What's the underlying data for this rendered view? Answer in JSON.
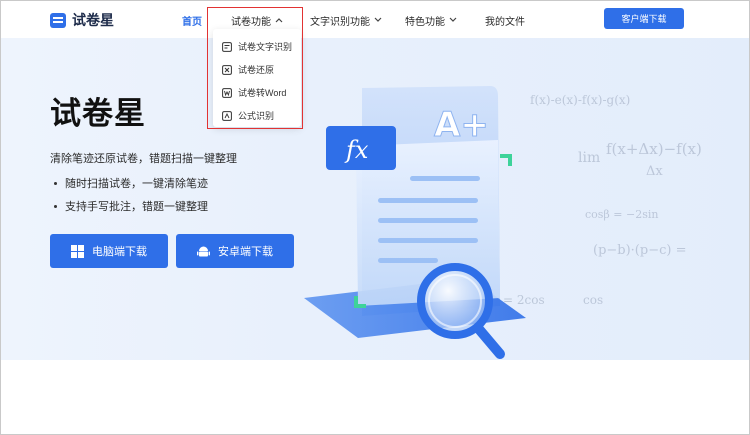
{
  "brand": {
    "name": "试卷星"
  },
  "nav": {
    "items": [
      {
        "label": "首页"
      },
      {
        "label": "试卷功能"
      },
      {
        "label": "文字识别功能"
      },
      {
        "label": "特色功能"
      },
      {
        "label": "我的文件"
      }
    ],
    "client_download": "客户端下载"
  },
  "dropdown": {
    "items": [
      {
        "label": "试卷文字识别",
        "icon": "doc-text-icon"
      },
      {
        "label": "试卷还原",
        "icon": "doc-restore-icon"
      },
      {
        "label": "试卷转Word",
        "icon": "doc-word-icon"
      },
      {
        "label": "公式识别",
        "icon": "formula-icon"
      }
    ]
  },
  "hero": {
    "title": "试卷星",
    "subtitle": "清除笔迹还原试卷，错题扫描一键整理",
    "bullets": [
      "随时扫描试卷，一键清除笔迹",
      "支持手写批注，错题一键整理"
    ],
    "pc_download": "电脑端下载",
    "android_download": "安卓端下载"
  },
  "illustration": {
    "fx_label": "fx",
    "grade_label": "A+"
  },
  "formulas": [
    "f(x)-e(x)-f(x)-g(x)",
    "f(x+Δx)−f(x)",
    "lim",
    "Δx",
    "cosβ = −2sin",
    "(p−b)·(p−c) =",
    "= 2cos",
    "cos"
  ],
  "colors": {
    "accent": "#2f6fe8",
    "highlight": "#e23333",
    "hero_bg": "#e8f0fc"
  }
}
